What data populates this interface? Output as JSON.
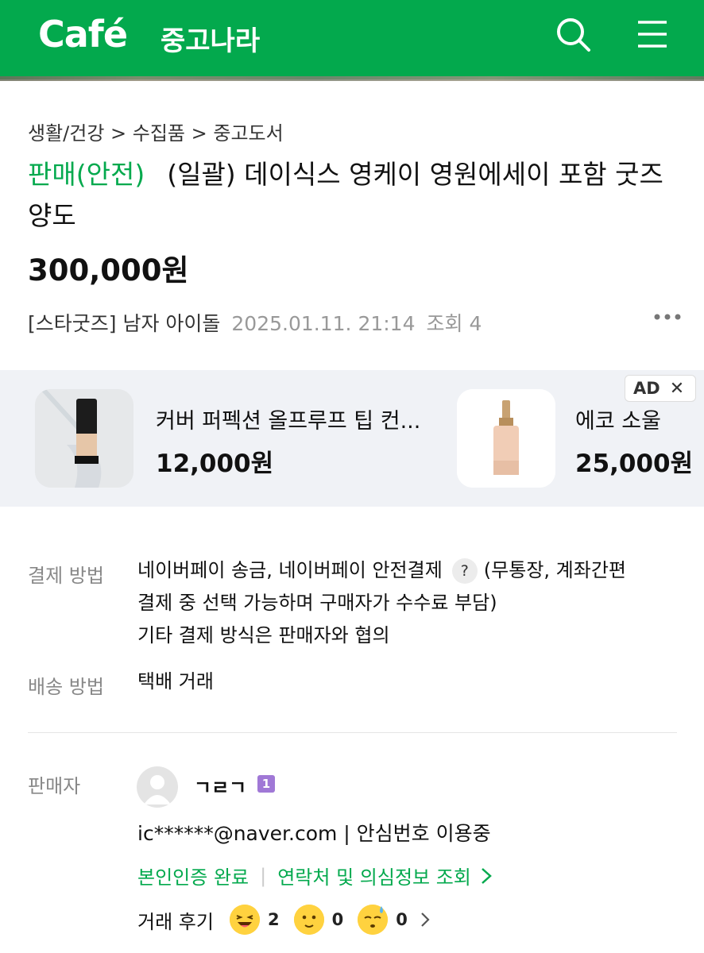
{
  "header": {
    "logo": "Café",
    "cafe_name": "중고나라"
  },
  "post": {
    "breadcrumb": "생활/건강 > 수집품 > 중고도서",
    "badge": "판매(안전)",
    "title": "(일괄) 데이식스 영케이 영원에세이 포함 굿즈 양도",
    "price": "300,000원",
    "category": "[스타굿즈] 남자 아이돌",
    "date": "2025.01.11. 21:14",
    "views": "조회 4"
  },
  "ads": {
    "badge": "AD",
    "close": "✕",
    "items": [
      {
        "title": "커버 퍼펙션 올프루프 팁 컨...",
        "price": "12,000원"
      },
      {
        "title": "에코 소울 ",
        "price": "25,000원"
      }
    ]
  },
  "details": {
    "payment_label": "결제 방법",
    "payment_line1a": "네이버페이 송금, 네이버페이 안전결제",
    "payment_help": "?",
    "payment_line1b": "(무통장, 계좌간편",
    "payment_line2": "결제 중 선택 가능하며 구매자가 수수료 부담)",
    "payment_line3": "기타 결제 방식은 판매자와 협의",
    "delivery_label": "배송 방법",
    "delivery_value": "택배 거래"
  },
  "seller": {
    "label": "판매자",
    "name": "ㄱㄹㄱ",
    "level": "1",
    "contact": "ic******@naver.com | 안심번호 이용중",
    "verified": "본인인증 완료",
    "lookup": "연락처 및 의심정보 조회",
    "review_label": "거래 후기",
    "reviews": [
      "2",
      "0",
      "0"
    ]
  },
  "colors": {
    "brand": "#03a94d",
    "level_badge": "#a078d6"
  }
}
